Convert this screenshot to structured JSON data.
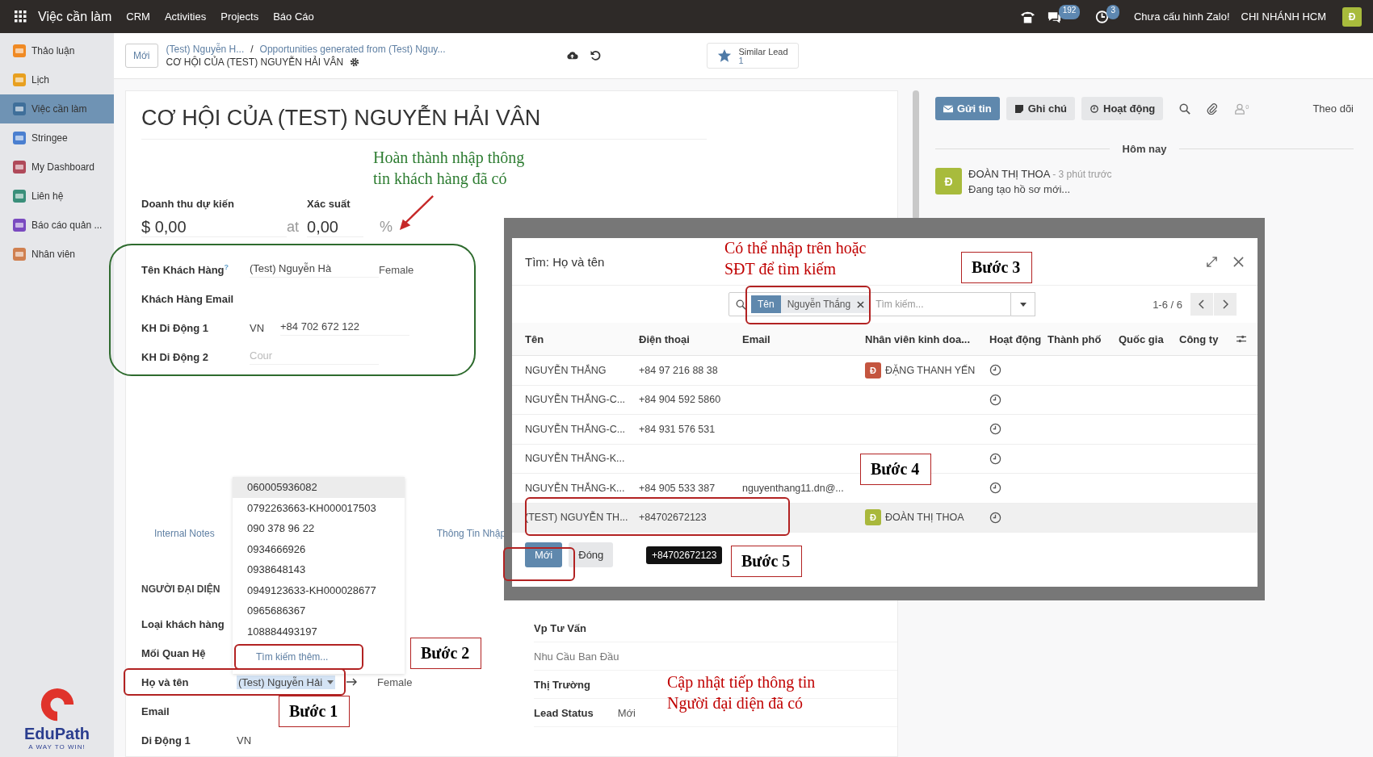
{
  "top_bar": {
    "app_name": "Việc cần làm",
    "menu": [
      "CRM",
      "Activities",
      "Projects",
      "Báo Cáo"
    ],
    "messages_count": "192",
    "activities_count": "3",
    "zalo": "Chưa cấu hình Zalo!",
    "company": "CHI NHÁNH HCM",
    "avatar": "Đ"
  },
  "sidebar": {
    "items": [
      {
        "label": "Thảo luận",
        "selected": false
      },
      {
        "label": "Lịch",
        "selected": false
      },
      {
        "label": "Việc cần làm",
        "selected": true
      },
      {
        "label": "Stringee",
        "selected": false
      },
      {
        "label": "My Dashboard",
        "selected": false
      },
      {
        "label": "Liên hệ",
        "selected": false
      },
      {
        "label": "Báo cáo quản ...",
        "selected": false
      },
      {
        "label": "Nhân viên",
        "selected": false
      }
    ],
    "logo": {
      "name": "EduPath",
      "tagline": "A WAY TO WIN!"
    }
  },
  "control_panel": {
    "new_button": "Mới",
    "breadcrumbs": [
      "(Test) Nguyễn H...",
      "Opportunities generated from (Test) Nguy..."
    ],
    "separator": "/",
    "current": "CƠ HỘI CỦA (TEST) NGUYỄN HẢI VÂN",
    "smart_button": {
      "label": "Similar Lead",
      "count": "1"
    }
  },
  "form": {
    "title": "CƠ HỘI CỦA (TEST) NGUYỄN HẢI VÂN",
    "revenue_label": "Doanh thu dự kiến",
    "revenue": "$ 0,00",
    "at": "at",
    "probability_label": "Xác suất",
    "probability": "0,00",
    "percent": "%",
    "customer_fields": [
      {
        "label": "Tên Khách Hàng",
        "help": "?",
        "value": "(Test) Nguyễn Hà",
        "extra": "Female"
      },
      {
        "label": "Khách Hàng Email"
      },
      {
        "label": "KH Di Động 1",
        "country": "VN",
        "value": "+84 702 672 122"
      },
      {
        "label": "KH Di Động 2",
        "placeholder": "Cour"
      }
    ],
    "tabs": [
      {
        "label": "Internal Notes",
        "selected": false
      },
      {
        "label": "Thông Tin Nhập",
        "selected": false
      }
    ],
    "section": "NGƯỜI ĐẠI DIỆN",
    "left_fields": [
      {
        "label": "Loại khách hàng"
      },
      {
        "label": "Mối Quan Hệ"
      },
      {
        "label": "Họ và tên",
        "value": "(Test) Nguyễn Hải",
        "focused": true,
        "extra": "Female"
      },
      {
        "label": "Email"
      },
      {
        "label": "Di Động 1",
        "country": "VN"
      }
    ],
    "right_fields": [
      {
        "label": "Vp Tư Vấn",
        "muted": false
      },
      {
        "label": "Nhu Cầu Ban Đầu",
        "muted": true
      },
      {
        "label": "Thị Trường",
        "muted": false
      },
      {
        "label": "Lead Status",
        "muted": false,
        "value": "Mới"
      }
    ]
  },
  "dropdown": {
    "items": [
      {
        "label": "060005936082",
        "selected": true
      },
      {
        "label": "0792263663-KH000017503",
        "selected": false
      },
      {
        "label": "090 378 96 22",
        "selected": false
      },
      {
        "label": "0934666926",
        "selected": false
      },
      {
        "label": "0938648143",
        "selected": false
      },
      {
        "label": "0949123633-KH000028677",
        "selected": false
      },
      {
        "label": "0965686367",
        "selected": false
      },
      {
        "label": "108884493197",
        "selected": false
      }
    ],
    "search_more": "Tìm kiếm thêm..."
  },
  "chatter": {
    "buttons": [
      {
        "label": "Gửi tin",
        "selected": true
      },
      {
        "label": "Ghi chú",
        "selected": false
      },
      {
        "label": "Hoạt động",
        "selected": false
      }
    ],
    "followers_count": "0",
    "follow": "Theo dõi",
    "date_separator": "Hôm nay",
    "message": {
      "avatar": "Đ",
      "author": "ĐOÀN THỊ THOA",
      "time": "- 3 phút trước",
      "body": "Đang tạo hồ sơ mới..."
    }
  },
  "dialog": {
    "title": "Tìm: Họ và tên",
    "facet": {
      "label": "Tên",
      "value": "Nguyễn Thắng"
    },
    "search_placeholder": "Tìm kiếm...",
    "pager": "1-6 / 6",
    "columns": [
      "Tên",
      "Điện thoại",
      "Email",
      "Nhân viên kinh doa...",
      "Hoạt động",
      "Thành phố",
      "Quốc gia",
      "Công ty"
    ],
    "rows": [
      {
        "name": "NGUYỄN THẮNG",
        "phone": "+84 97 216 88 38",
        "salesperson": {
          "avatar": "Đ",
          "name": "ĐẶNG THANH YẾN",
          "color": "#c4553f"
        },
        "selected": false
      },
      {
        "name": "NGUYỄN THẮNG-C...",
        "phone": "+84 904 592 5860",
        "selected": false
      },
      {
        "name": "NGUYỄN THẮNG-C...",
        "phone": "+84 931 576 531",
        "selected": false
      },
      {
        "name": "NGUYỄN THẮNG-K...",
        "selected": false
      },
      {
        "name": "NGUYỄN THẮNG-K...",
        "phone": "+84 905 533 387",
        "email": "nguyenthang11.dn@...",
        "selected": false
      },
      {
        "name": "(TEST) NGUYỄN TH...",
        "phone": "+84702672123",
        "salesperson": {
          "avatar": "Đ",
          "name": "ĐOÀN THỊ THOA",
          "color": "#a9b83c"
        },
        "selected": true
      }
    ],
    "tooltip": "+84702672123",
    "buttons": [
      {
        "label": "Mới",
        "primary": true
      },
      {
        "label": "Đóng",
        "primary": false
      }
    ]
  },
  "annotations": {
    "notes": [
      {
        "lines": [
          "Hoàn thành nhập thông",
          "tin khách hàng đã có"
        ],
        "color": "#2e7d32"
      },
      {
        "lines": [
          "Có thể nhập trên hoặc",
          "SĐT để tìm kiếm"
        ],
        "color": "#c00000"
      },
      {
        "lines": [
          "Cập nhật tiếp thông tin",
          "Người đại diện đã có"
        ],
        "color": "#c00000"
      }
    ],
    "steps": [
      "Bước 1",
      "Bước 2",
      "Bước 3",
      "Bước 4",
      "Bước 5"
    ]
  }
}
